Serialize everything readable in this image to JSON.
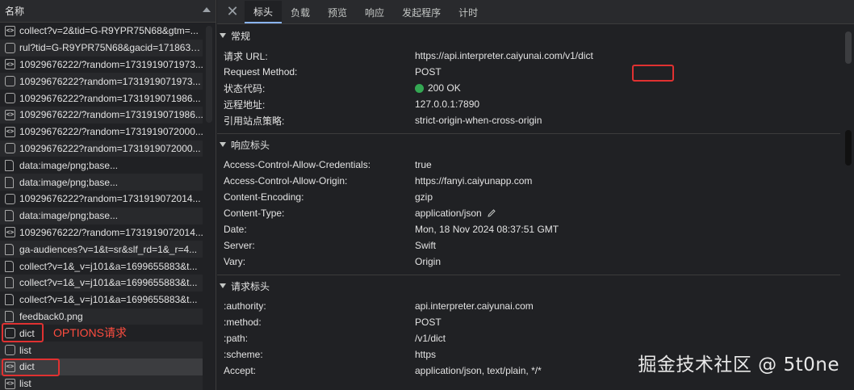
{
  "left_panel": {
    "header_title": "名称",
    "requests": [
      {
        "icon": "code",
        "name": "collect?v=2&tid=G-R9YPR75N68&gtm=..."
      },
      {
        "icon": "plain",
        "name": "rul?tid=G-R9YPR75N68&gacid=1718630..."
      },
      {
        "icon": "code",
        "name": "10929676222/?random=1731919071973..."
      },
      {
        "icon": "plain",
        "name": "10929676222?random=1731919071973..."
      },
      {
        "icon": "plain",
        "name": "10929676222?random=1731919071986..."
      },
      {
        "icon": "code",
        "name": "10929676222/?random=1731919071986..."
      },
      {
        "icon": "code",
        "name": "10929676222/?random=1731919072000..."
      },
      {
        "icon": "plain",
        "name": "10929676222?random=1731919072000..."
      },
      {
        "icon": "doc",
        "name": "data:image/png;base..."
      },
      {
        "icon": "doc",
        "name": "data:image/png;base..."
      },
      {
        "icon": "plain",
        "name": "10929676222?random=1731919072014..."
      },
      {
        "icon": "doc",
        "name": "data:image/png;base..."
      },
      {
        "icon": "code",
        "name": "10929676222/?random=1731919072014..."
      },
      {
        "icon": "doc",
        "name": "ga-audiences?v=1&t=sr&slf_rd=1&_r=4..."
      },
      {
        "icon": "doc",
        "name": "collect?v=1&_v=j101&a=1699655883&t..."
      },
      {
        "icon": "doc",
        "name": "collect?v=1&_v=j101&a=1699655883&t..."
      },
      {
        "icon": "doc",
        "name": "collect?v=1&_v=j101&a=1699655883&t..."
      },
      {
        "icon": "doc",
        "name": "feedback0.png"
      },
      {
        "icon": "plain",
        "name": "dict"
      },
      {
        "icon": "plain",
        "name": "list"
      },
      {
        "icon": "code",
        "name": "dict"
      },
      {
        "icon": "code",
        "name": "list"
      }
    ],
    "annotation_label": "OPTIONS请求"
  },
  "tabs": [
    "标头",
    "负载",
    "预览",
    "响应",
    "发起程序",
    "计时"
  ],
  "general": {
    "title": "常规",
    "rows": [
      {
        "k": "请求 URL:",
        "v": "https://api.interpreter.caiyunai.com/v1/dict"
      },
      {
        "k": "Request Method:",
        "v": "POST"
      },
      {
        "k": "状态代码:",
        "v": "200 OK"
      },
      {
        "k": "远程地址:",
        "v": "127.0.0.1:7890"
      },
      {
        "k": "引用站点策略:",
        "v": "strict-origin-when-cross-origin"
      }
    ]
  },
  "response_headers": {
    "title": "响应标头",
    "rows": [
      {
        "k": "Access-Control-Allow-Credentials:",
        "v": "true"
      },
      {
        "k": "Access-Control-Allow-Origin:",
        "v": "https://fanyi.caiyunapp.com"
      },
      {
        "k": "Content-Encoding:",
        "v": "gzip"
      },
      {
        "k": "Content-Type:",
        "v": "application/json"
      },
      {
        "k": "Date:",
        "v": "Mon, 18 Nov 2024 08:37:51 GMT"
      },
      {
        "k": "Server:",
        "v": "Swift"
      },
      {
        "k": "Vary:",
        "v": "Origin"
      }
    ]
  },
  "request_headers": {
    "title": "请求标头",
    "rows": [
      {
        "k": ":authority:",
        "v": "api.interpreter.caiyunai.com"
      },
      {
        "k": ":method:",
        "v": "POST"
      },
      {
        "k": ":path:",
        "v": "/v1/dict"
      },
      {
        "k": ":scheme:",
        "v": "https"
      },
      {
        "k": "Accept:",
        "v": "application/json, text/plain, */*"
      }
    ]
  },
  "watermark": "掘金技术社区 @ 5t0ne",
  "colors": {
    "status_ok": "#34a853",
    "highlight": "#e03131",
    "accent": "#8ab4f8"
  }
}
